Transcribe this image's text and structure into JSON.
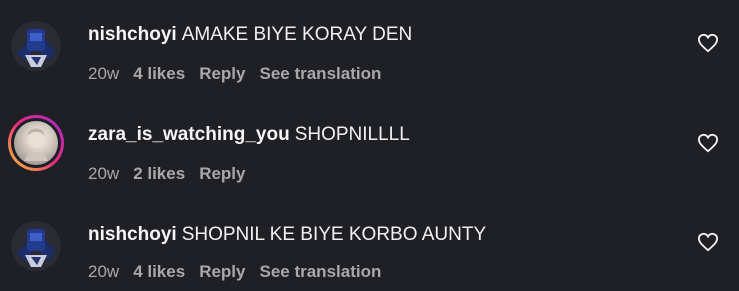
{
  "comments": [
    {
      "username": "nishchoyi",
      "text": "AMAKE BIYE KORAY DEN",
      "age": "20w",
      "likes": "4 likes",
      "reply_label": "Reply",
      "translation_label": "See translation",
      "avatar_icon": "navy-figure-avatar"
    },
    {
      "username": "zara_is_watching_you",
      "text": "SHOPNILLLL",
      "age": "20w",
      "likes": "2 likes",
      "reply_label": "Reply",
      "avatar_icon": "photo-avatar-with-story-ring"
    },
    {
      "username": "nishchoyi",
      "text": "SHOPNIL KE BIYE KORBO AUNTY",
      "age": "20w",
      "likes": "4 likes",
      "reply_label": "Reply",
      "translation_label": "See translation",
      "avatar_icon": "navy-figure-avatar"
    }
  ],
  "colors": {
    "background": "#1f2025",
    "text_primary": "#f1f1f1",
    "text_secondary": "#a8a8a8"
  },
  "icons": {
    "like": "heart-icon"
  }
}
